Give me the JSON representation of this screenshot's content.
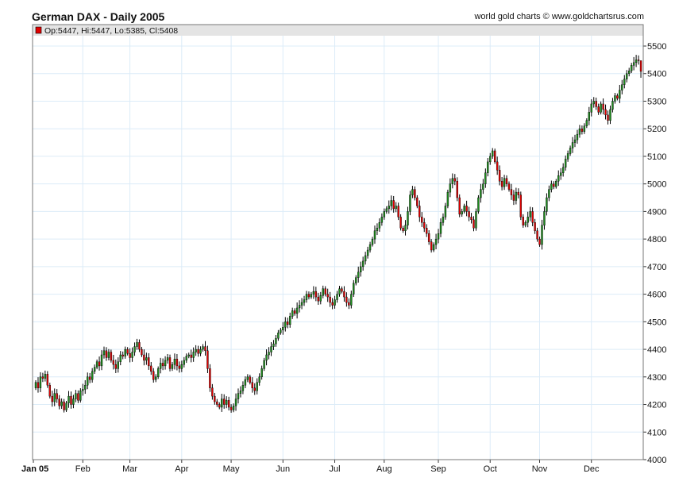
{
  "header": {
    "title": "German DAX - Daily 2005",
    "credit": "world gold charts © www.goldchartsrus.com",
    "readout": "Op:5447, Hi:5447, Lo:5385, Cl:5408"
  },
  "colors": {
    "up": "#1e8c1e",
    "down": "#e00000",
    "grid": "#dcecf8",
    "band": "#e4e4e4"
  },
  "chart_data": {
    "type": "candlestick",
    "title": "German DAX - Daily 2005",
    "ylim": [
      4000,
      5500
    ],
    "yticks": [
      4000,
      4100,
      4200,
      4300,
      4400,
      4500,
      4600,
      4700,
      4800,
      4900,
      5000,
      5100,
      5200,
      5300,
      5400,
      5500
    ],
    "months": [
      {
        "label": "Jan 05",
        "start_index": 0
      },
      {
        "label": "Feb",
        "start_index": 21
      },
      {
        "label": "Mar",
        "start_index": 41
      },
      {
        "label": "Apr",
        "start_index": 63
      },
      {
        "label": "May",
        "start_index": 84
      },
      {
        "label": "Jun",
        "start_index": 106
      },
      {
        "label": "Jul",
        "start_index": 128
      },
      {
        "label": "Aug",
        "start_index": 149
      },
      {
        "label": "Sep",
        "start_index": 172
      },
      {
        "label": "Oct",
        "start_index": 194
      },
      {
        "label": "Nov",
        "start_index": 215
      },
      {
        "label": "Dec",
        "start_index": 237
      }
    ],
    "first_open": 4260,
    "last": {
      "open": 5447,
      "high": 5447,
      "low": 5385,
      "close": 5408
    },
    "closes": [
      4280,
      4260,
      4300,
      4295,
      4310,
      4270,
      4230,
      4210,
      4240,
      4220,
      4195,
      4210,
      4180,
      4205,
      4230,
      4200,
      4220,
      4240,
      4215,
      4250,
      4255,
      4270,
      4300,
      4290,
      4320,
      4335,
      4355,
      4340,
      4380,
      4395,
      4370,
      4390,
      4360,
      4345,
      4330,
      4355,
      4380,
      4375,
      4400,
      4385,
      4370,
      4390,
      4410,
      4425,
      4400,
      4380,
      4360,
      4370,
      4340,
      4320,
      4290,
      4300,
      4330,
      4350,
      4340,
      4360,
      4370,
      4330,
      4345,
      4365,
      4340,
      4330,
      4345,
      4360,
      4375,
      4380,
      4370,
      4390,
      4400,
      4385,
      4400,
      4410,
      4395,
      4330,
      4260,
      4230,
      4210,
      4200,
      4190,
      4220,
      4200,
      4215,
      4190,
      4180,
      4195,
      4220,
      4240,
      4250,
      4270,
      4290,
      4300,
      4280,
      4260,
      4250,
      4280,
      4300,
      4330,
      4360,
      4380,
      4390,
      4410,
      4420,
      4440,
      4460,
      4470,
      4480,
      4500,
      4490,
      4520,
      4540,
      4530,
      4550,
      4560,
      4570,
      4580,
      4600,
      4590,
      4600,
      4610,
      4590,
      4575,
      4595,
      4620,
      4600,
      4590,
      4570,
      4560,
      4580,
      4600,
      4620,
      4610,
      4590,
      4570,
      4560,
      4600,
      4640,
      4660,
      4680,
      4700,
      4720,
      4740,
      4760,
      4780,
      4800,
      4830,
      4840,
      4860,
      4880,
      4900,
      4910,
      4920,
      4940,
      4910,
      4920,
      4880,
      4840,
      4830,
      4850,
      4900,
      4960,
      4980,
      4950,
      4920,
      4880,
      4860,
      4840,
      4820,
      4790,
      4760,
      4780,
      4800,
      4820,
      4860,
      4880,
      4920,
      4970,
      5000,
      5020,
      5010,
      4950,
      4890,
      4900,
      4920,
      4900,
      4880,
      4870,
      4840,
      4900,
      4950,
      4980,
      5000,
      5040,
      5080,
      5100,
      5120,
      5080,
      5050,
      5010,
      4990,
      5020,
      5000,
      4980,
      4960,
      4940,
      4970,
      4960,
      4880,
      4850,
      4860,
      4880,
      4900,
      4860,
      4830,
      4800,
      4780,
      4850,
      4900,
      4950,
      4980,
      5000,
      4990,
      5010,
      5030,
      5040,
      5060,
      5090,
      5110,
      5130,
      5150,
      5160,
      5180,
      5200,
      5190,
      5210,
      5230,
      5260,
      5290,
      5300,
      5280,
      5260,
      5290,
      5270,
      5250,
      5230,
      5270,
      5300,
      5320,
      5310,
      5340,
      5360,
      5380,
      5400,
      5410,
      5430,
      5440,
      5450,
      5447,
      5408
    ]
  }
}
